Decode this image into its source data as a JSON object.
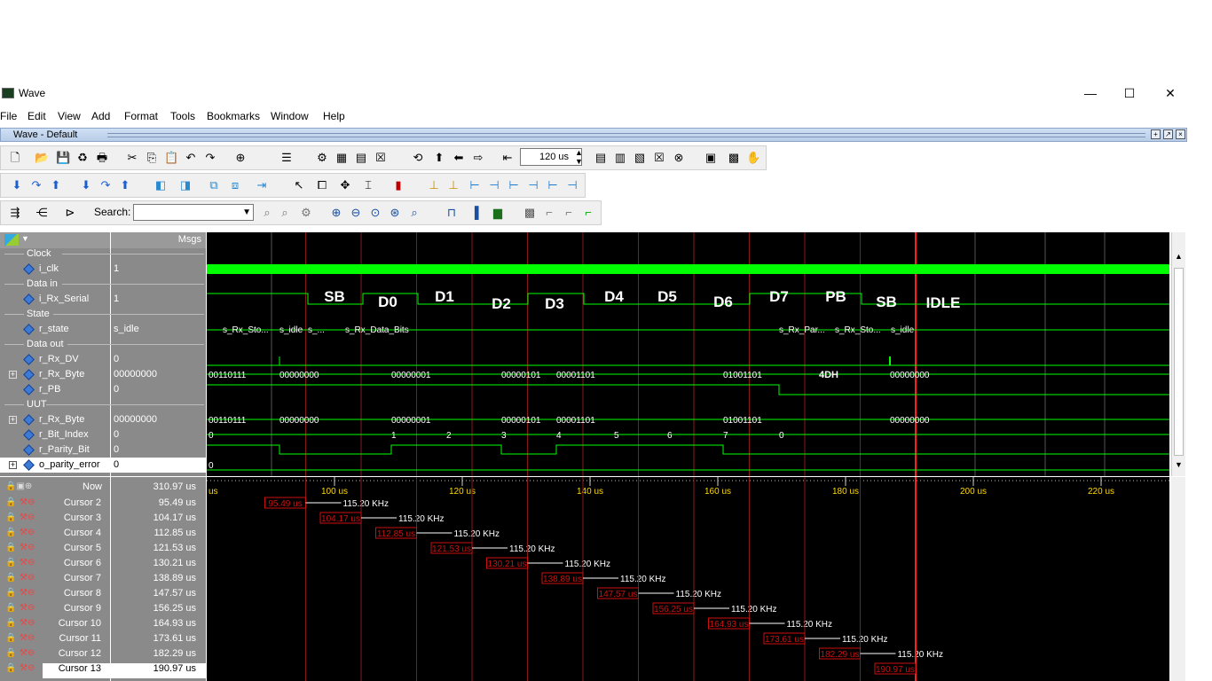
{
  "window": {
    "title": "Wave",
    "minimize": "—",
    "maximize": "☐",
    "close": "✕"
  },
  "menu": [
    "File",
    "Edit",
    "View",
    "Add",
    "Format",
    "Tools",
    "Bookmarks",
    "Window",
    "Help"
  ],
  "subwindow": {
    "title": "Wave - Default"
  },
  "toolbar": {
    "time_value": "120 us",
    "search_label": "Search:",
    "search_value": ""
  },
  "columns": {
    "name_header": "",
    "msgs_header": "Msgs"
  },
  "groups": [
    {
      "label": "Clock"
    },
    {
      "label": "Data in"
    },
    {
      "label": "State"
    },
    {
      "label": "Data out"
    },
    {
      "label": "UUT"
    }
  ],
  "signals": [
    {
      "name": "i_clk",
      "value": "1",
      "expandable": false
    },
    {
      "name": "i_Rx_Serial",
      "value": "1",
      "expandable": false
    },
    {
      "name": "r_state",
      "value": "s_idle",
      "expandable": false
    },
    {
      "name": "r_Rx_DV",
      "value": "0",
      "expandable": false
    },
    {
      "name": "r_Rx_Byte",
      "value": "00000000",
      "expandable": true
    },
    {
      "name": "r_PB",
      "value": "0",
      "expandable": false
    },
    {
      "name": "r_Rx_Byte",
      "value": "00000000",
      "expandable": true
    },
    {
      "name": "r_Bit_Index",
      "value": "0",
      "expandable": false
    },
    {
      "name": "r_Parity_Bit",
      "value": "0",
      "expandable": false
    },
    {
      "name": "o_parity_error",
      "value": "0",
      "expandable": true
    }
  ],
  "frame_labels": [
    "SB",
    "D0",
    "D1",
    "D2",
    "D3",
    "D4",
    "D5",
    "D6",
    "D7",
    "PB",
    "SB",
    "IDLE"
  ],
  "state_labels": [
    "s_Rx_Sto...",
    "s_idle",
    "s_...",
    "s_Rx_Data_Bits",
    "s_Rx_Par...",
    "s_Rx_Sto...",
    "s_idle"
  ],
  "byte_labels": [
    "00110111",
    "00000000",
    "00000001",
    "00000101",
    "00001101",
    "01001101",
    "4DH",
    "00000000"
  ],
  "byte2_labels": [
    "00110111",
    "00000000",
    "00000001",
    "00000101",
    "00001101",
    "01001101",
    "00000000"
  ],
  "bit_index_labels": [
    "0",
    "1",
    "2",
    "3",
    "4",
    "5",
    "6",
    "7",
    "0"
  ],
  "zero_label": "0",
  "timeline": {
    "unit_left": "us",
    "ticks": [
      "100 us",
      "120 us",
      "140 us",
      "160 us",
      "180 us",
      "200 us",
      "220 us"
    ]
  },
  "now": {
    "label": "Now",
    "value": "310.97 us"
  },
  "cursors": [
    {
      "label": "Cursor 2",
      "value": "95.49 us",
      "delta": "115.20 KHz"
    },
    {
      "label": "Cursor 3",
      "value": "104.17 us",
      "delta": "115.20 KHz"
    },
    {
      "label": "Cursor 4",
      "value": "112.85 us",
      "delta": "115.20 KHz"
    },
    {
      "label": "Cursor 5",
      "value": "121.53 us",
      "delta": "115.20 KHz"
    },
    {
      "label": "Cursor 6",
      "value": "130.21 us",
      "delta": "115.20 KHz"
    },
    {
      "label": "Cursor 7",
      "value": "138.89 us",
      "delta": "115.20 KHz"
    },
    {
      "label": "Cursor 8",
      "value": "147.57 us",
      "delta": "115.20 KHz"
    },
    {
      "label": "Cursor 9",
      "value": "156.25 us",
      "delta": "115.20 KHz"
    },
    {
      "label": "Cursor 10",
      "value": "164.93 us",
      "delta": "115.20 KHz"
    },
    {
      "label": "Cursor 11",
      "value": "173.61 us",
      "delta": "115.20 KHz"
    },
    {
      "label": "Cursor 12",
      "value": "182.29 us",
      "delta": "115.20 KHz"
    },
    {
      "label": "Cursor 13",
      "value": "190.97 us",
      "delta": ""
    }
  ],
  "colors": {
    "wave_green": "#00ff00",
    "cursor_red": "#cc1111",
    "active_cursor": "#ff2020",
    "panel_gray": "#8a8a8a"
  }
}
